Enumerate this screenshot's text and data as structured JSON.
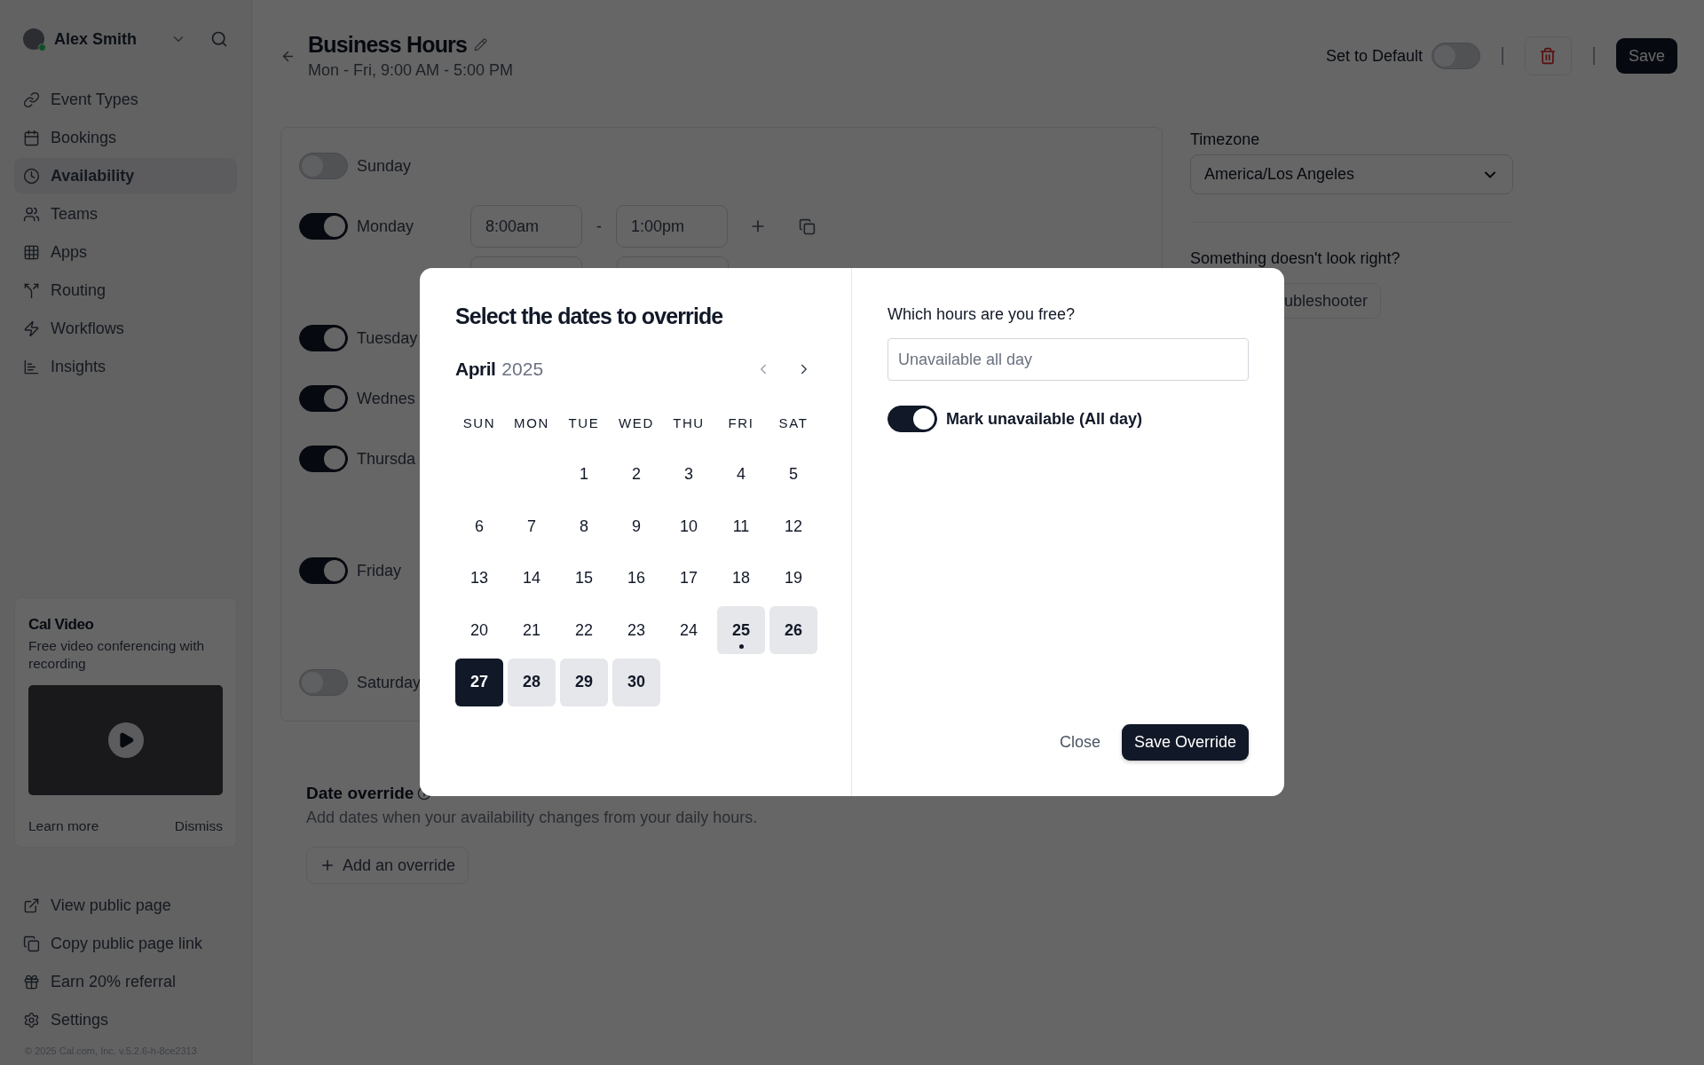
{
  "sidebar": {
    "user": {
      "name": "Alex Smith",
      "online": true
    },
    "nav": [
      {
        "kind": "link",
        "label": "Event Types",
        "selected": false
      },
      {
        "kind": "calendar",
        "label": "Bookings",
        "selected": false
      },
      {
        "kind": "clock",
        "label": "Availability",
        "selected": true
      },
      {
        "kind": "users",
        "label": "Teams",
        "selected": false
      },
      {
        "kind": "grid",
        "label": "Apps",
        "selected": false
      },
      {
        "kind": "split",
        "label": "Routing",
        "selected": false
      },
      {
        "kind": "zap",
        "label": "Workflows",
        "selected": false
      },
      {
        "kind": "chart",
        "label": "Insights",
        "selected": false
      }
    ],
    "promo": {
      "title": "Cal Video",
      "text": "Free video conferencing with recording",
      "learn_more": "Learn more",
      "dismiss": "Dismiss"
    },
    "links": [
      {
        "kind": "external",
        "label": "View public page"
      },
      {
        "kind": "copy",
        "label": "Copy public page link"
      },
      {
        "kind": "gift",
        "label": "Earn 20% referral"
      },
      {
        "kind": "settings",
        "label": "Settings"
      }
    ],
    "footer": "© 2025 Cal.com, Inc. v.5.2.6-h-8ce2313"
  },
  "header": {
    "title": "Business Hours",
    "subtitle": "Mon - Fri, 9:00 AM - 5:00 PM",
    "set_default": {
      "label": "Set to Default",
      "on": false
    },
    "save": "Save"
  },
  "schedule": {
    "days": [
      {
        "label": "Sunday",
        "on": false
      },
      {
        "label": "Monday",
        "on": true,
        "slots": [
          {
            "kind": "times",
            "start": "8:00am",
            "separator": "-",
            "end": "1:00pm"
          },
          {
            "kind": "empty"
          }
        ]
      },
      {
        "label": "Tuesday",
        "on": true,
        "slots": [
          {
            "kind": "empty"
          }
        ]
      },
      {
        "label": "Wednes",
        "on": true,
        "slots": [
          {
            "kind": "empty"
          }
        ]
      },
      {
        "label": "Thursda",
        "on": true,
        "slots": [
          {
            "kind": "empty"
          },
          {
            "kind": "empty"
          }
        ]
      },
      {
        "label": "Friday",
        "on": true,
        "slots": [
          {
            "kind": "empty"
          },
          {
            "kind": "empty"
          }
        ]
      },
      {
        "label": "Saturday",
        "on": false
      }
    ]
  },
  "overrides": {
    "title": "Date override",
    "description": "Add dates when your availability changes from your daily hours.",
    "add_button": "Add an override"
  },
  "side": {
    "timezone_label": "Timezone",
    "timezone": "America/Los Angeles",
    "question": "Something doesn't look right?",
    "troubleshooter": "ubleshooter"
  },
  "dialog": {
    "title": "Select the dates to override",
    "month": "April",
    "year": "2025",
    "weekdays": [
      "SUN",
      "MON",
      "TUE",
      "WED",
      "THU",
      "FRI",
      "SAT"
    ],
    "days": [
      {
        "kind": "blank"
      },
      {
        "kind": "blank"
      },
      {
        "kind": "day",
        "label": "1",
        "available": false,
        "selected": false,
        "today": false
      },
      {
        "kind": "day",
        "label": "2",
        "available": false,
        "selected": false,
        "today": false
      },
      {
        "kind": "day",
        "label": "3",
        "available": false,
        "selected": false,
        "today": false
      },
      {
        "kind": "day",
        "label": "4",
        "available": false,
        "selected": false,
        "today": false
      },
      {
        "kind": "day",
        "label": "5",
        "available": false,
        "selected": false,
        "today": false
      },
      {
        "kind": "day",
        "label": "6",
        "available": false,
        "selected": false,
        "today": false
      },
      {
        "kind": "day",
        "label": "7",
        "available": false,
        "selected": false,
        "today": false
      },
      {
        "kind": "day",
        "label": "8",
        "available": false,
        "selected": false,
        "today": false
      },
      {
        "kind": "day",
        "label": "9",
        "available": false,
        "selected": false,
        "today": false
      },
      {
        "kind": "day",
        "label": "10",
        "available": false,
        "selected": false,
        "today": false
      },
      {
        "kind": "day",
        "label": "11",
        "available": false,
        "selected": false,
        "today": false
      },
      {
        "kind": "day",
        "label": "12",
        "available": false,
        "selected": false,
        "today": false
      },
      {
        "kind": "day",
        "label": "13",
        "available": false,
        "selected": false,
        "today": false
      },
      {
        "kind": "day",
        "label": "14",
        "available": false,
        "selected": false,
        "today": false
      },
      {
        "kind": "day",
        "label": "15",
        "available": false,
        "selected": false,
        "today": false
      },
      {
        "kind": "day",
        "label": "16",
        "available": false,
        "selected": false,
        "today": false
      },
      {
        "kind": "day",
        "label": "17",
        "available": false,
        "selected": false,
        "today": false
      },
      {
        "kind": "day",
        "label": "18",
        "available": false,
        "selected": false,
        "today": false
      },
      {
        "kind": "day",
        "label": "19",
        "available": false,
        "selected": false,
        "today": false
      },
      {
        "kind": "day",
        "label": "20",
        "available": false,
        "selected": false,
        "today": false
      },
      {
        "kind": "day",
        "label": "21",
        "available": false,
        "selected": false,
        "today": false
      },
      {
        "kind": "day",
        "label": "22",
        "available": false,
        "selected": false,
        "today": false
      },
      {
        "kind": "day",
        "label": "23",
        "available": false,
        "selected": false,
        "today": false
      },
      {
        "kind": "day",
        "label": "24",
        "available": false,
        "selected": false,
        "today": false
      },
      {
        "kind": "day",
        "label": "25",
        "available": true,
        "selected": false,
        "today": true
      },
      {
        "kind": "day",
        "label": "26",
        "available": true,
        "selected": false,
        "today": false
      },
      {
        "kind": "day",
        "label": "27",
        "available": true,
        "selected": true,
        "today": false
      },
      {
        "kind": "day",
        "label": "28",
        "available": true,
        "selected": false,
        "today": false
      },
      {
        "kind": "day",
        "label": "29",
        "available": true,
        "selected": false,
        "today": false
      },
      {
        "kind": "day",
        "label": "30",
        "available": true,
        "selected": false,
        "today": false
      }
    ],
    "question": "Which hours are you free?",
    "placeholder": "Unavailable all day",
    "unavailable": {
      "label": "Mark unavailable (All day)",
      "on": true
    },
    "close": "Close",
    "save": "Save Override"
  }
}
